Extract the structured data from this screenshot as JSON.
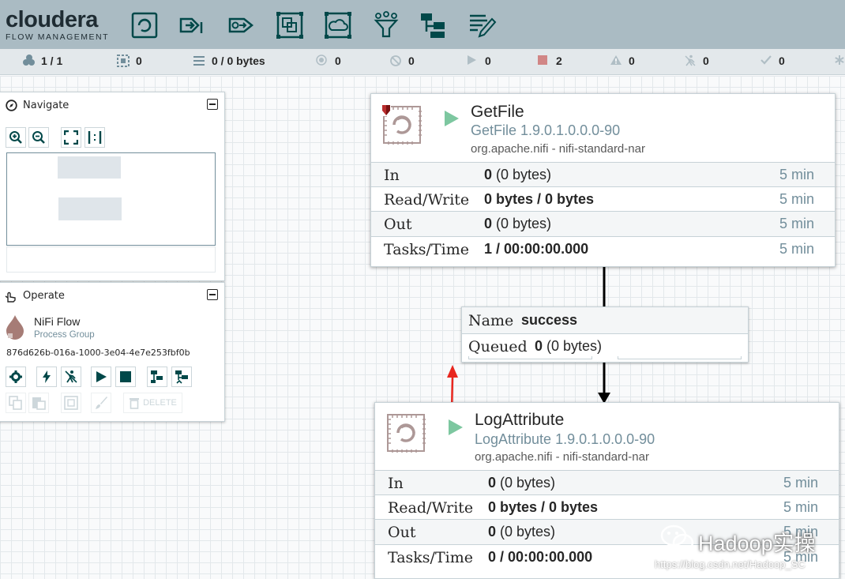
{
  "header": {
    "logo_main": "cloudera",
    "logo_sub": "FLOW MANAGEMENT",
    "toolbar": [
      "processor-icon",
      "input-port-icon",
      "output-port-icon",
      "process-group-icon",
      "remote-process-group-icon",
      "funnel-icon",
      "template-icon",
      "label-icon"
    ]
  },
  "status": {
    "threads": "1 / 1",
    "transmitting": "0",
    "queued": "0 / 0 bytes",
    "invalid_remote": "0",
    "not_transmitting": "0",
    "running": "0",
    "stopped": "2",
    "invalid": "0",
    "disabled": "0",
    "up_to_date": "0"
  },
  "navigate": {
    "title": "Navigate"
  },
  "operate": {
    "title": "Operate",
    "group_name": "NiFi Flow",
    "group_type": "Process Group",
    "group_id": "876d626b-016a-1000-3e04-4e7e253fbf0b",
    "delete_label": "DELETE"
  },
  "processors": [
    {
      "name": "GetFile",
      "type": "GetFile 1.9.0.1.0.0.0-90",
      "bundle": "org.apache.nifi - nifi-standard-nar",
      "rows": [
        {
          "label": "In",
          "value_bold": "0",
          "value_rest": " (0 bytes)",
          "time": "5 min"
        },
        {
          "label": "Read/Write",
          "value_bold": "0 bytes / 0 bytes",
          "value_rest": "",
          "time": "5 min"
        },
        {
          "label": "Out",
          "value_bold": "0",
          "value_rest": " (0 bytes)",
          "time": "5 min"
        },
        {
          "label": "Tasks/Time",
          "value_bold": "1 / 00:00:00.000",
          "value_rest": "",
          "time": "5 min"
        }
      ]
    },
    {
      "name": "LogAttribute",
      "type": "LogAttribute 1.9.0.1.0.0.0-90",
      "bundle": "org.apache.nifi - nifi-standard-nar",
      "rows": [
        {
          "label": "In",
          "value_bold": "0",
          "value_rest": " (0 bytes)",
          "time": "5 min"
        },
        {
          "label": "Read/Write",
          "value_bold": "0 bytes / 0 bytes",
          "value_rest": "",
          "time": "5 min"
        },
        {
          "label": "Out",
          "value_bold": "0",
          "value_rest": " (0 bytes)",
          "time": "5 min"
        },
        {
          "label": "Tasks/Time",
          "value_bold": "0 / 00:00:00.000",
          "value_rest": "",
          "time": "5 min"
        }
      ]
    }
  ],
  "connection": {
    "name_label": "Name",
    "name_value": "success",
    "queued_label": "Queued",
    "queued_bold": "0",
    "queued_rest": " (0 bytes)"
  },
  "watermark": {
    "text": "Hadoop实操",
    "url": "https://blog.csdn.net/Hadoop_SC"
  },
  "colors": {
    "header_bg": "#aabbc3",
    "status_bg": "#e3e8eb",
    "run_green": "#7dc7a0",
    "stopped_red": "#d18686",
    "text_dark": "#262626",
    "type_blue": "#728e9b",
    "annotation_red": "#e8261e"
  }
}
